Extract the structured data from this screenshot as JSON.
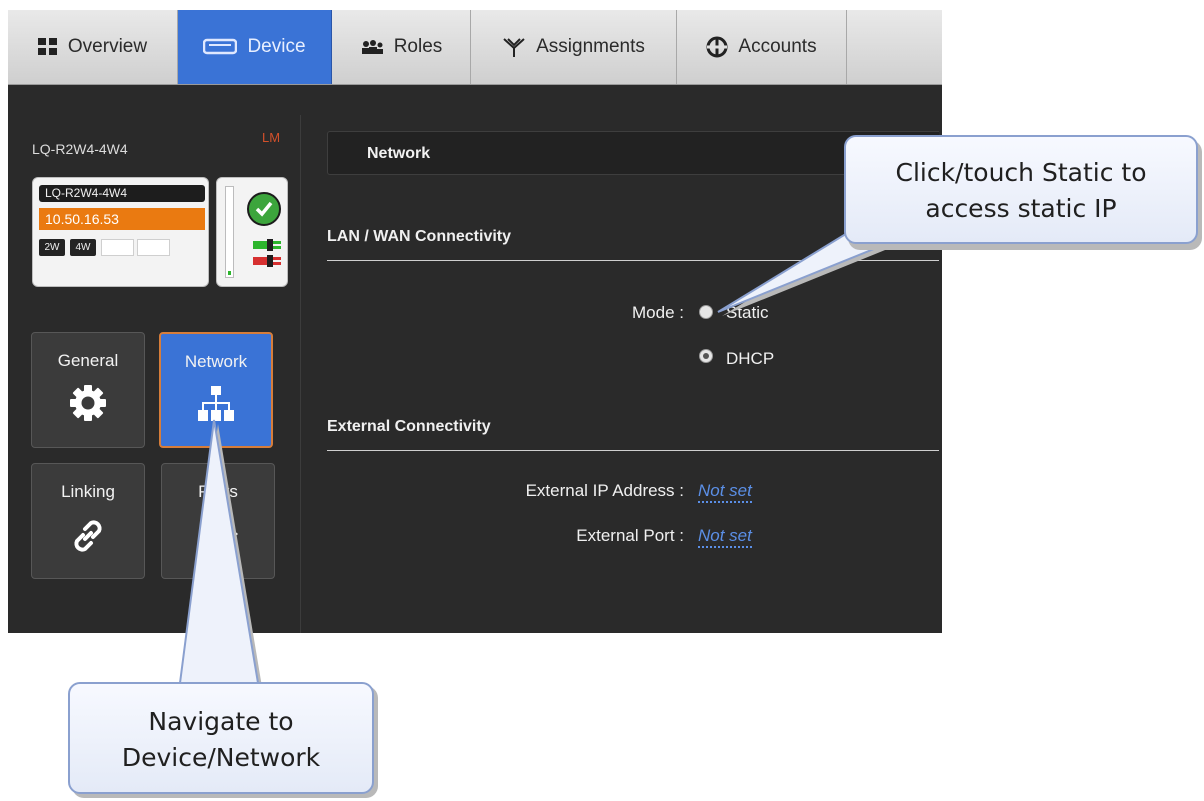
{
  "tabs": [
    {
      "label": "Overview",
      "icon": "grid-icon",
      "active": false
    },
    {
      "label": "Device",
      "icon": "device-icon",
      "active": true
    },
    {
      "label": "Roles",
      "icon": "people-icon",
      "active": false
    },
    {
      "label": "Assignments",
      "icon": "assignments-icon",
      "active": false
    },
    {
      "label": "Accounts",
      "icon": "accounts-icon",
      "active": false
    }
  ],
  "device": {
    "name": "LQ-R2W4-4W4",
    "badge": "LM",
    "card_name": "LQ-R2W4-4W4",
    "ip": "10.50.16.53",
    "chips": [
      "2W",
      "4W"
    ],
    "meter_level": 0.05
  },
  "tiles": [
    {
      "label": "General",
      "icon": "gear-icon",
      "active": false
    },
    {
      "label": "Network",
      "icon": "network-icon",
      "active": true
    },
    {
      "label": "Linking",
      "icon": "link-icon",
      "active": false
    },
    {
      "label": "Ports",
      "icon": "play-icon",
      "active": false
    }
  ],
  "section": {
    "title": "Network",
    "lan_heading": "LAN / WAN Connectivity",
    "mode_label": "Mode :",
    "mode_options": [
      {
        "label": "Static",
        "selected": false
      },
      {
        "label": "DHCP",
        "selected": true
      }
    ],
    "external_heading": "External Connectivity",
    "external_ip_label": "External IP Address :",
    "external_ip_value": "Not set",
    "external_port_label": "External Port :",
    "external_port_value": "Not set"
  },
  "callouts": {
    "static_line1": "Click/touch Static to",
    "static_line2": "access static IP",
    "nav_line1": "Navigate to",
    "nav_line2": "Device/Network"
  },
  "colors": {
    "accent": "#3a73d6",
    "panel_bg": "#2a2a2a",
    "ip_orange": "#ea7a11",
    "link": "#5b8fe6",
    "badge": "#d2502a"
  }
}
